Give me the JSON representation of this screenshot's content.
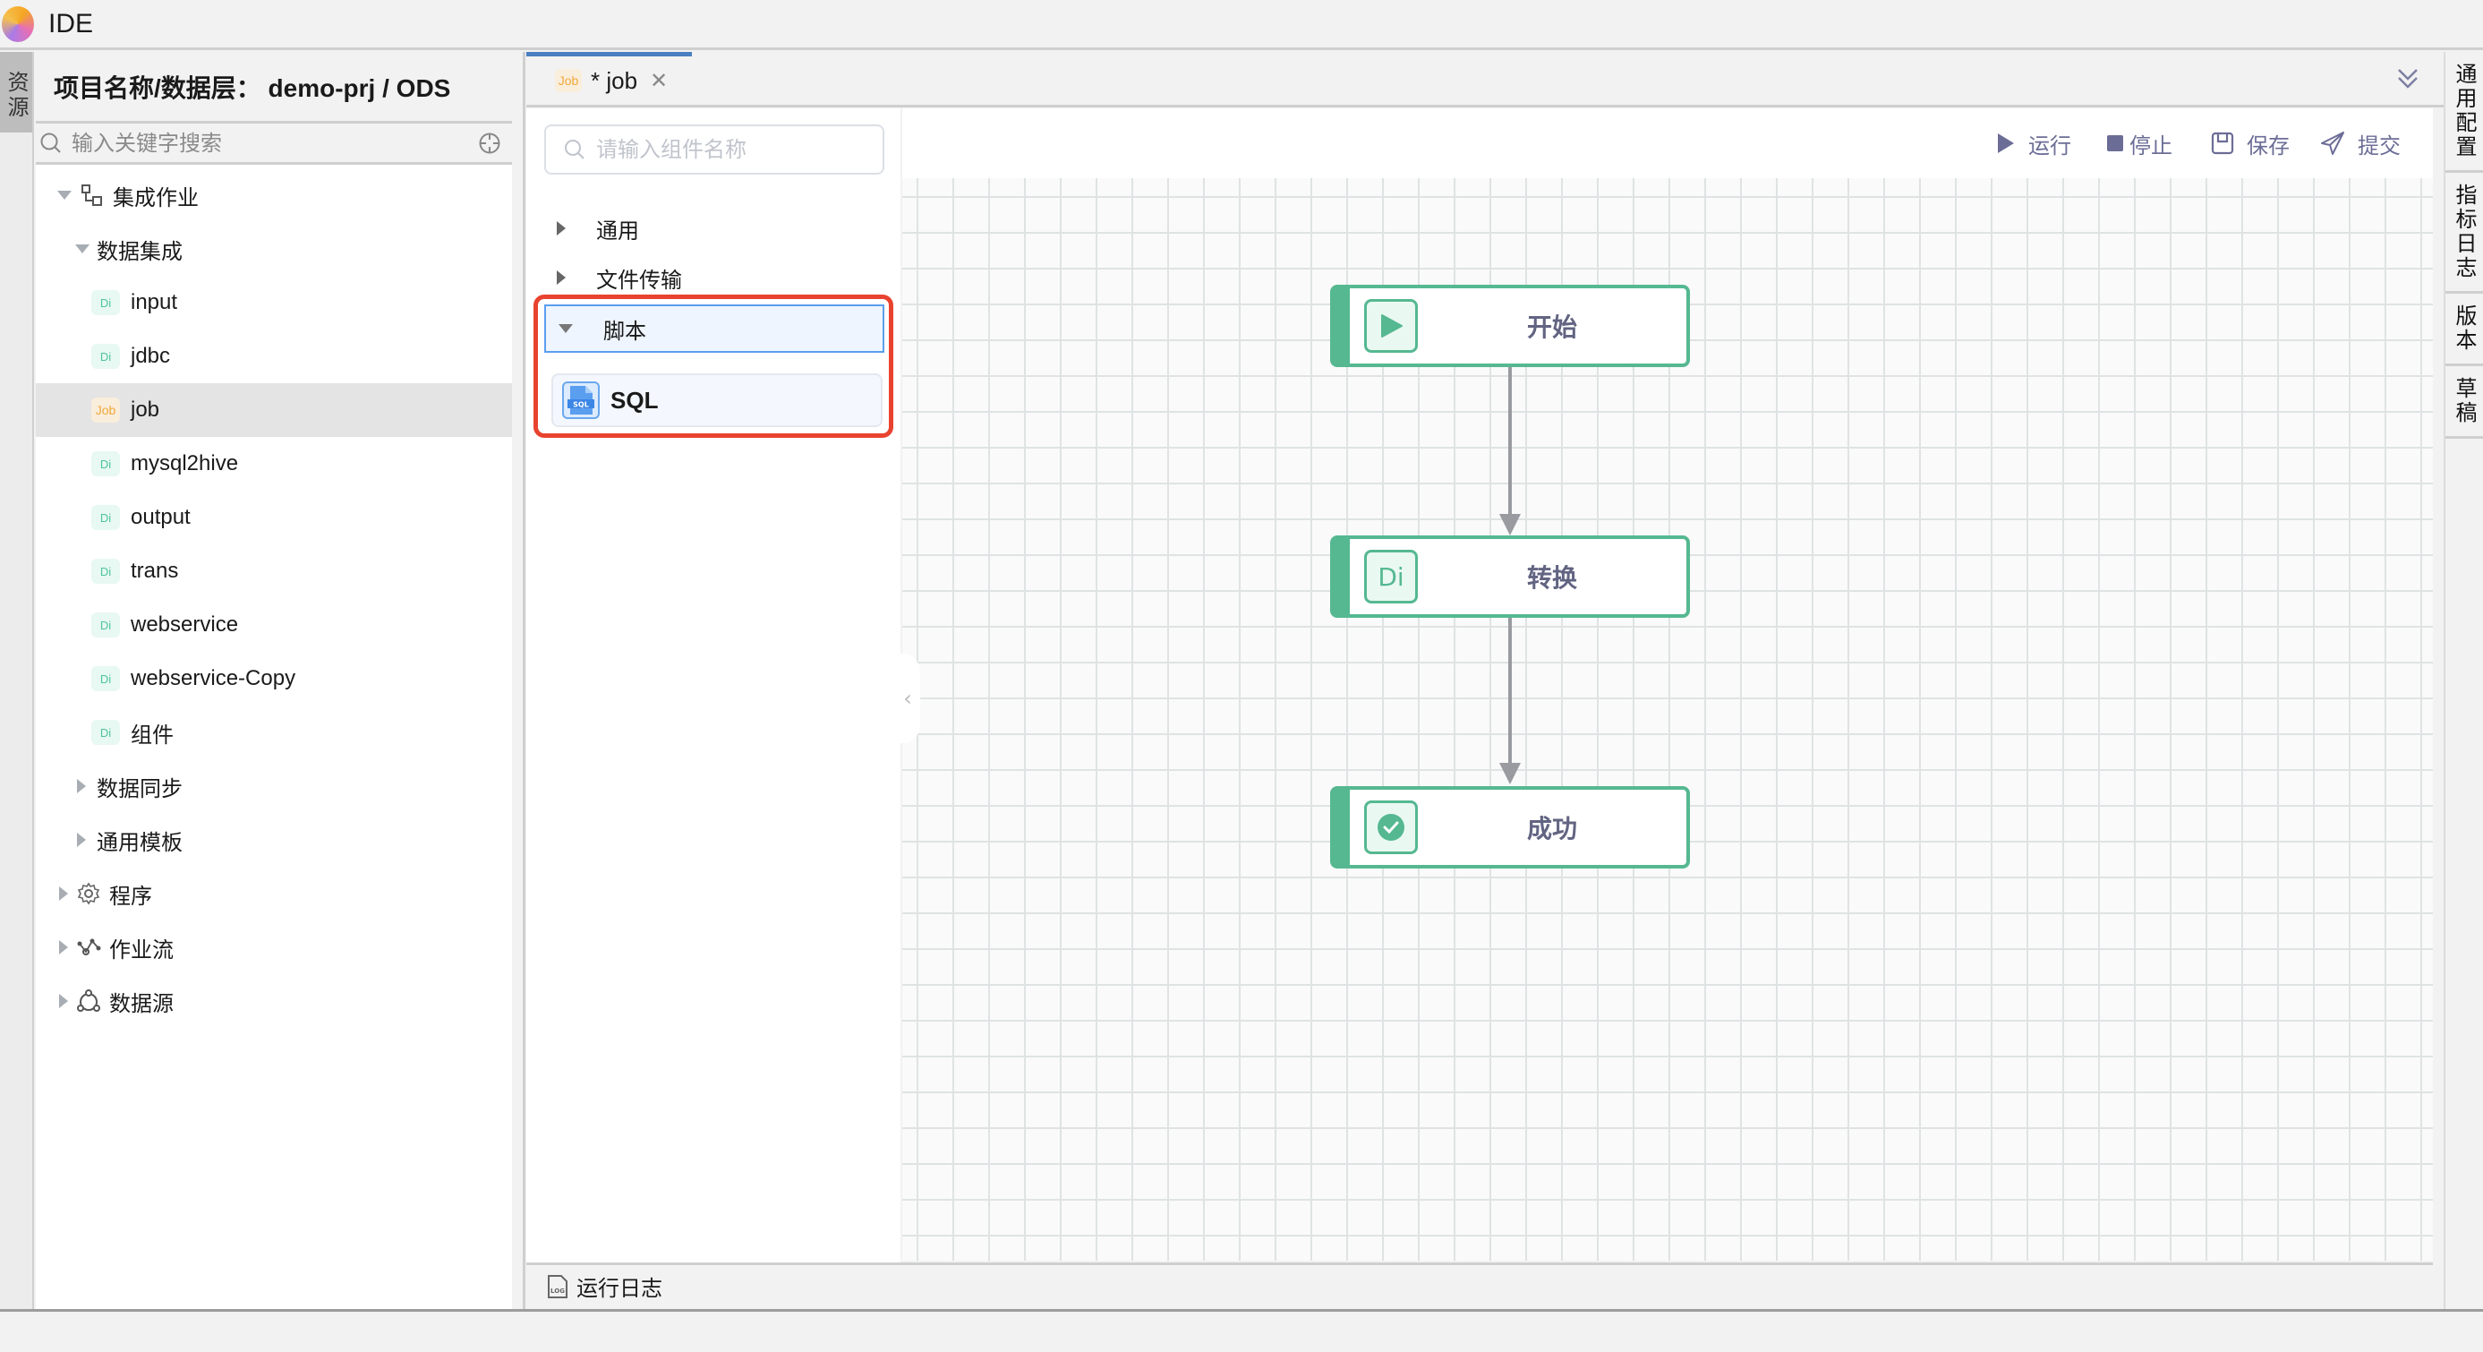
{
  "app": {
    "title": "IDE",
    "logo": "app-logo"
  },
  "left_strip": {
    "tabs": [
      {
        "label": "资源",
        "active": true
      }
    ]
  },
  "tree_panel": {
    "project_title": "项目名称/数据层： demo-prj / ODS",
    "search_placeholder": "输入关键字搜索",
    "search_icon": "search-icon",
    "locate_icon": "crosshair-icon",
    "items": [
      {
        "label": "集成作业",
        "level": 0,
        "expanded": true,
        "icon": "integration-job-icon"
      },
      {
        "label": "数据集成",
        "level": 1,
        "expanded": true
      },
      {
        "label": "input",
        "level": 2,
        "badge": "Di"
      },
      {
        "label": "jdbc",
        "level": 2,
        "badge": "Di"
      },
      {
        "label": "job",
        "level": 2,
        "badge": "Job",
        "selected": true
      },
      {
        "label": "mysql2hive",
        "level": 2,
        "badge": "Di"
      },
      {
        "label": "output",
        "level": 2,
        "badge": "Di"
      },
      {
        "label": "trans",
        "level": 2,
        "badge": "Di"
      },
      {
        "label": "webservice",
        "level": 2,
        "badge": "Di"
      },
      {
        "label": "webservice-Copy",
        "level": 2,
        "badge": "Di"
      },
      {
        "label": "组件",
        "level": 2,
        "badge": "Di"
      },
      {
        "label": "数据同步",
        "level": 1,
        "expanded": false
      },
      {
        "label": "通用模板",
        "level": 1,
        "expanded": false
      },
      {
        "label": "程序",
        "level": 0,
        "expanded": false,
        "icon": "gear-icon"
      },
      {
        "label": "作业流",
        "level": 0,
        "expanded": false,
        "icon": "workflow-icon"
      },
      {
        "label": "数据源",
        "level": 0,
        "expanded": false,
        "icon": "datasource-icon"
      }
    ]
  },
  "editor_tabs": [
    {
      "badge": "Job",
      "label": "* job",
      "active": true,
      "modified": true
    }
  ],
  "component_panel": {
    "search_placeholder": "请输入组件名称",
    "categories": [
      {
        "label": "通用",
        "expanded": false
      },
      {
        "label": "文件传输",
        "expanded": false
      },
      {
        "label": "脚本",
        "expanded": true,
        "selected": true,
        "highlighted": true
      }
    ],
    "components": [
      {
        "label": "SQL",
        "icon": "sql-file-icon",
        "icon_text": "SQL",
        "category": "脚本"
      }
    ]
  },
  "toolbar": {
    "run_label": "运行",
    "stop_label": "停止",
    "save_label": "保存",
    "submit_label": "提交"
  },
  "flow": {
    "nodes": [
      {
        "label": "开始",
        "icon": "play-icon"
      },
      {
        "label": "转换",
        "icon": "di-icon",
        "icon_text": "Di"
      },
      {
        "label": "成功",
        "icon": "check-circle-icon"
      }
    ],
    "edges": [
      {
        "from": "开始",
        "to": "转换"
      },
      {
        "from": "转换",
        "to": "成功"
      }
    ]
  },
  "right_strip": {
    "tabs": [
      "通用配置",
      "指标日志",
      "版本",
      "草稿"
    ]
  },
  "log_bar": {
    "label": "运行日志",
    "icon": "log-file-icon"
  },
  "colors": {
    "accent_green": "#55b891",
    "toolbar_purple": "#6b6d96",
    "highlight_red": "#e8432f",
    "selection_blue": "#5b9ef0",
    "tab_indicator": "#4a7fc1",
    "job_badge": "#f1a93a",
    "di_badge": "#4cc59a"
  }
}
